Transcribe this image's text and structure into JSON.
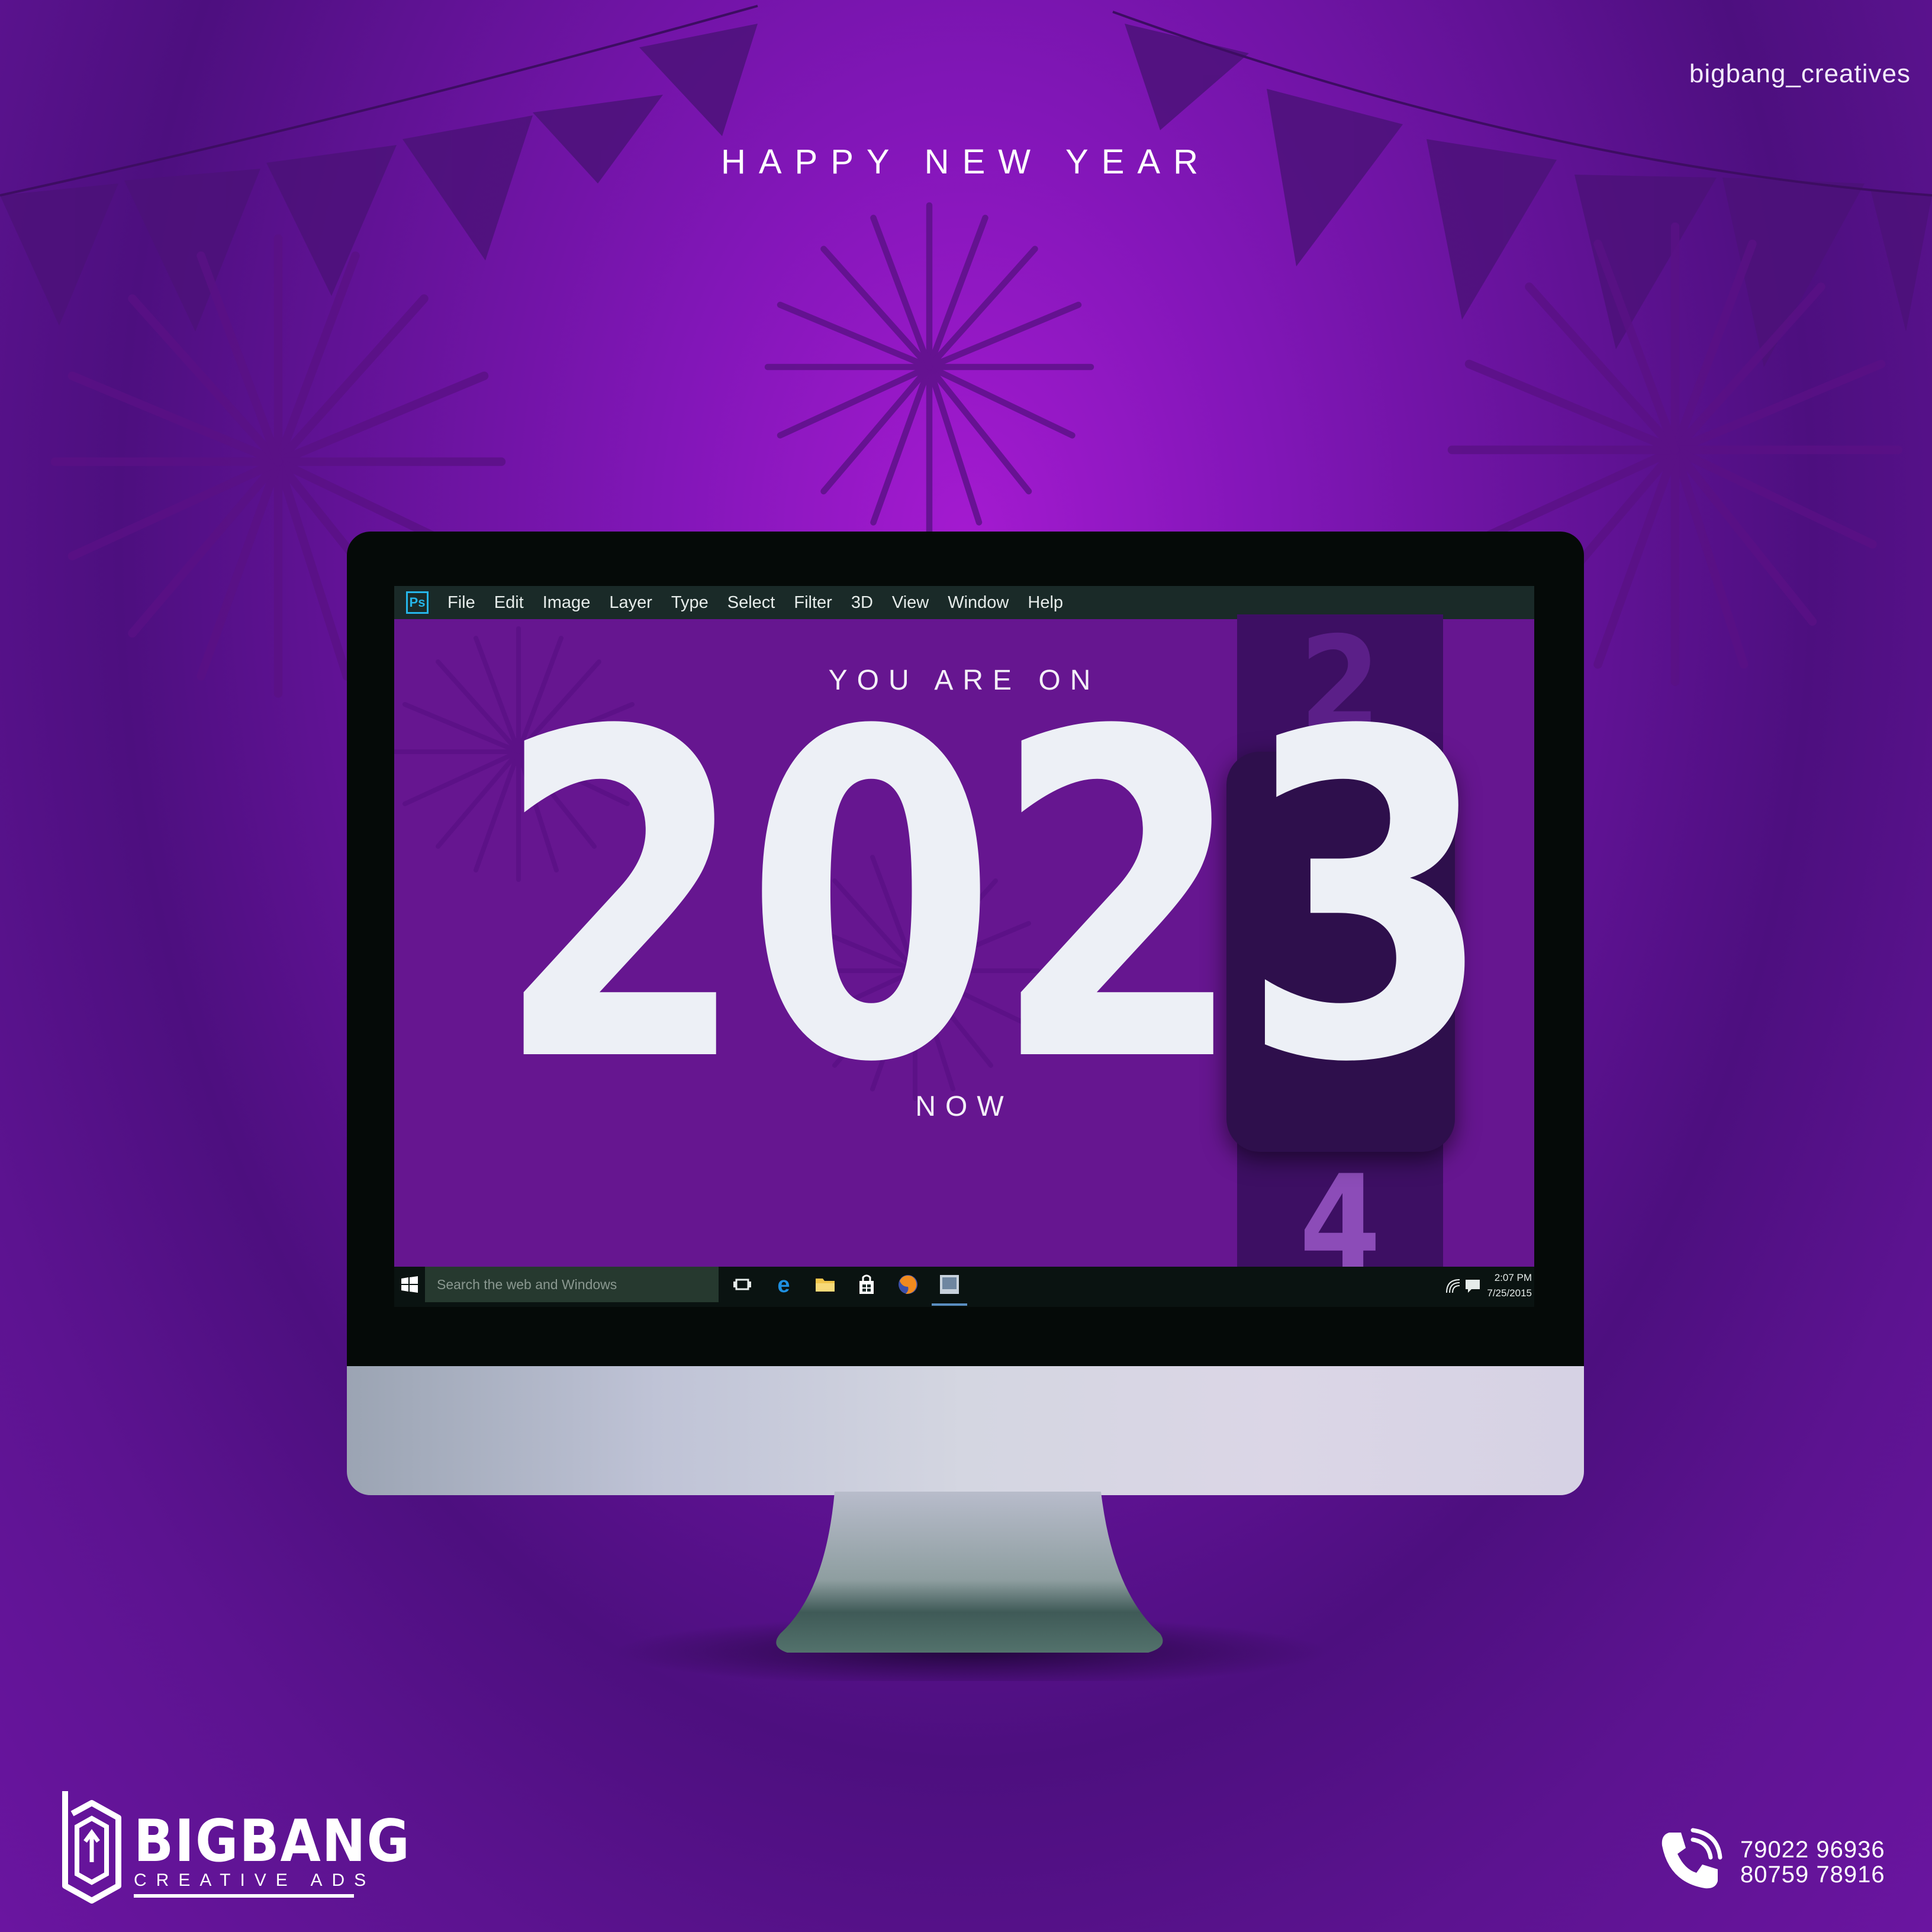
{
  "poster": {
    "handle": "bigbang_creatives",
    "headline": "HAPPY NEW YEAR",
    "phones": [
      "79022 96936",
      "80759 78916"
    ],
    "logo": {
      "name": "BIGBANG",
      "tagline": "CREATIVE ADS"
    }
  },
  "app": {
    "icon_label": "Ps",
    "menu": [
      "File",
      "Edit",
      "Image",
      "Layer",
      "Type",
      "Select",
      "Filter",
      "3D",
      "View",
      "Window",
      "Help"
    ]
  },
  "canvas": {
    "top_text": "YOU ARE ON",
    "bottom_text": "NOW",
    "year_digits": [
      "2",
      "0",
      "2",
      "3"
    ],
    "drum_above": "2",
    "drum_below": "4"
  },
  "taskbar": {
    "search_placeholder": "Search the web and Windows",
    "time": "2:07 PM",
    "date": "7/25/2015",
    "icons": [
      "task-view-icon",
      "edge-icon",
      "file-explorer-icon",
      "store-icon",
      "firefox-icon",
      "photos-icon"
    ]
  },
  "colors": {
    "background": "#6a15a0",
    "screen": "#661690",
    "accent_drum": "#3d0f63",
    "digit": "#edf0f6",
    "menubar": "#1a2a28"
  }
}
